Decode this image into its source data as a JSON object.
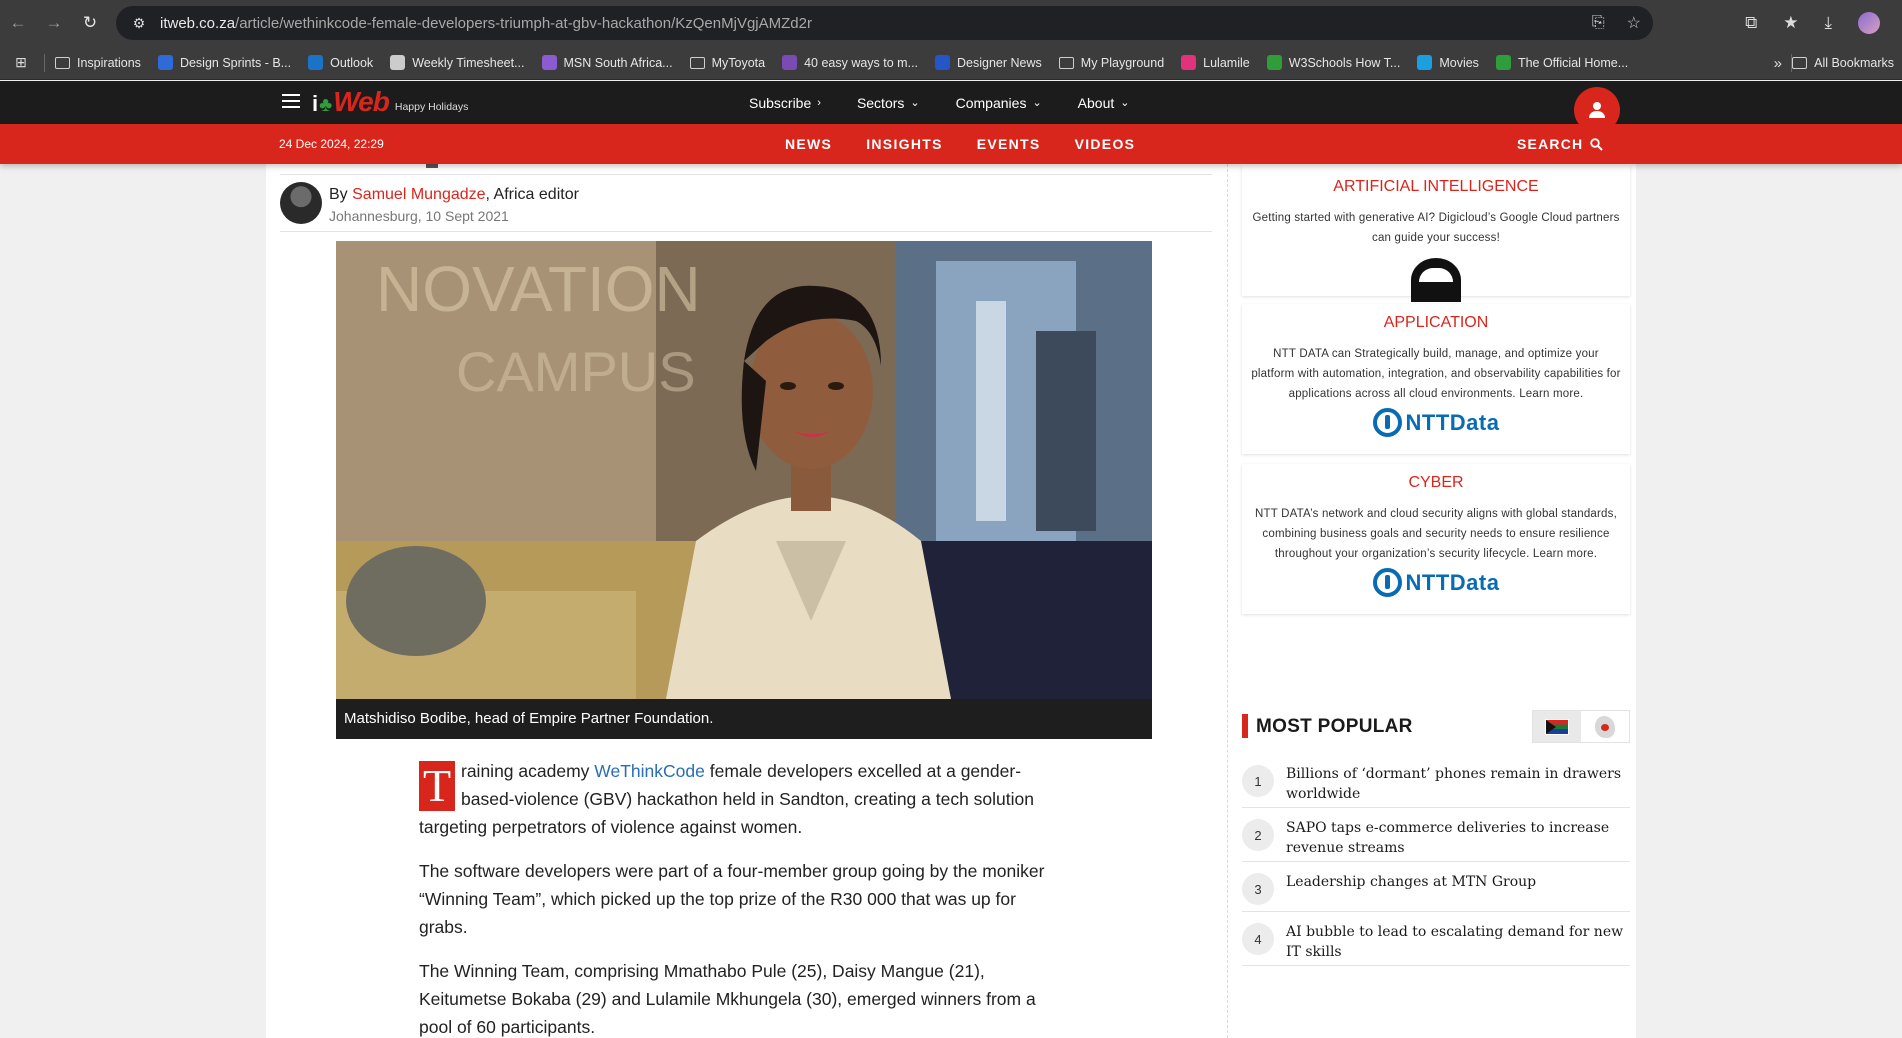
{
  "browser": {
    "url_domain": "itweb.co.za",
    "url_path": "/article/wethinkcode-female-developers-triumph-at-gbv-hackathon/KzQenMjVgjAMZd2r",
    "bookmarks": [
      {
        "label": "Inspirations",
        "icon": "folder-icon",
        "color": ""
      },
      {
        "label": "Design Sprints - B...",
        "icon": "teams-icon",
        "color": "#2f6bd8"
      },
      {
        "label": "Outlook",
        "icon": "outlook-icon",
        "color": "#1a73c8"
      },
      {
        "label": "Weekly Timesheet...",
        "icon": "timesheet-icon",
        "color": "#cccccc"
      },
      {
        "label": "MSN South Africa...",
        "icon": "msn-icon",
        "color": "#8a5cd0"
      },
      {
        "label": "MyToyota",
        "icon": "folder-icon",
        "color": ""
      },
      {
        "label": "40 easy ways to m...",
        "icon": "article-icon",
        "color": "#7a4bb5"
      },
      {
        "label": "Designer News",
        "icon": "designer-news-icon",
        "color": "#2456c8"
      },
      {
        "label": "My Playground",
        "icon": "folder-icon",
        "color": ""
      },
      {
        "label": "Lulamile",
        "icon": "lulamile-icon",
        "color": "#e0337a"
      },
      {
        "label": "W3Schools How T...",
        "icon": "w3schools-icon",
        "color": "#2e9d3a"
      },
      {
        "label": "Movies",
        "icon": "movies-icon",
        "color": "#1aa0e0"
      },
      {
        "label": "The Official Home...",
        "icon": "official-home-icon",
        "color": "#2e9d3a"
      }
    ],
    "more_glyph": "»",
    "all_bookmarks": "All Bookmarks"
  },
  "site": {
    "logo_prefix": "i",
    "logo_word": "Web",
    "tagline": "Happy Holidays",
    "nav": [
      {
        "label": "Subscribe",
        "chevron": "›"
      },
      {
        "label": "Sectors",
        "chevron": "⌄"
      },
      {
        "label": "Companies",
        "chevron": "⌄"
      },
      {
        "label": "About",
        "chevron": "⌄"
      }
    ],
    "date": "24 Dec 2024, 22:29",
    "subnav": [
      "NEWS",
      "INSIGHTS",
      "EVENTS",
      "VIDEOS"
    ],
    "search_label": "SEARCH"
  },
  "article": {
    "byline_prefix": "By ",
    "author": "Samuel Mungadze",
    "author_role": ", Africa editor",
    "dateline": "Johannesburg, 10 Sept 2021",
    "caption": "Matshidiso Bodibe, head of Empire Partner Foundation.",
    "p1_dropcap": "T",
    "p1_pre": "raining academy ",
    "p1_link": "WeThinkCode",
    "p1_post": " female developers excelled at a gender-based-violence (GBV) hackathon held in Sandton, creating a tech solution targeting perpetrators of violence against women.",
    "p2": "The software developers were part of a four-member group going by the moniker “Winning Team”, which picked up the top prize of the R30 000 that was up for grabs.",
    "p3": "The Winning Team, comprising Mmathabo Pule (25), Daisy Mangue (21), Keitumetse Bokaba (29) and Lulamile Mkhungela (30), emerged winners from a pool of 60 participants."
  },
  "sidebar": {
    "promos": [
      {
        "title": "ARTIFICIAL INTELLIGENCE",
        "text": "Getting started with generative AI? Digicloud’s Google Cloud partners can guide your success!",
        "logo": "digicloud-logo"
      },
      {
        "title": "APPLICATION",
        "text": "NTT DATA can Strategically build, manage, and optimize your platform with automation, integration, and observability capabilities for applications across all cloud environments. Learn more.",
        "logo": "ntt-data-logo"
      },
      {
        "title": "CYBER",
        "text": "NTT DATA’s network and cloud security aligns with global standards, combining business goals and security needs to ensure resilience throughout your organization’s security lifecycle. Learn more.",
        "logo": "ntt-data-logo"
      }
    ],
    "ntt_word": "NTTData",
    "most_popular_title": "MOST POPULAR",
    "popular": [
      {
        "num": "1",
        "title": "Billions of ‘dormant’ phones remain in drawers worldwide"
      },
      {
        "num": "2",
        "title": "SAPO taps e-commerce deliveries to increase revenue streams"
      },
      {
        "num": "3",
        "title": "Leadership changes at MTN Group"
      },
      {
        "num": "4",
        "title": "AI bubble to lead to escalating demand for new IT skills"
      }
    ]
  },
  "colors": {
    "brand_red": "#d9261c",
    "link_blue": "#2a6db5",
    "ntt_blue": "#0a6bb5"
  }
}
